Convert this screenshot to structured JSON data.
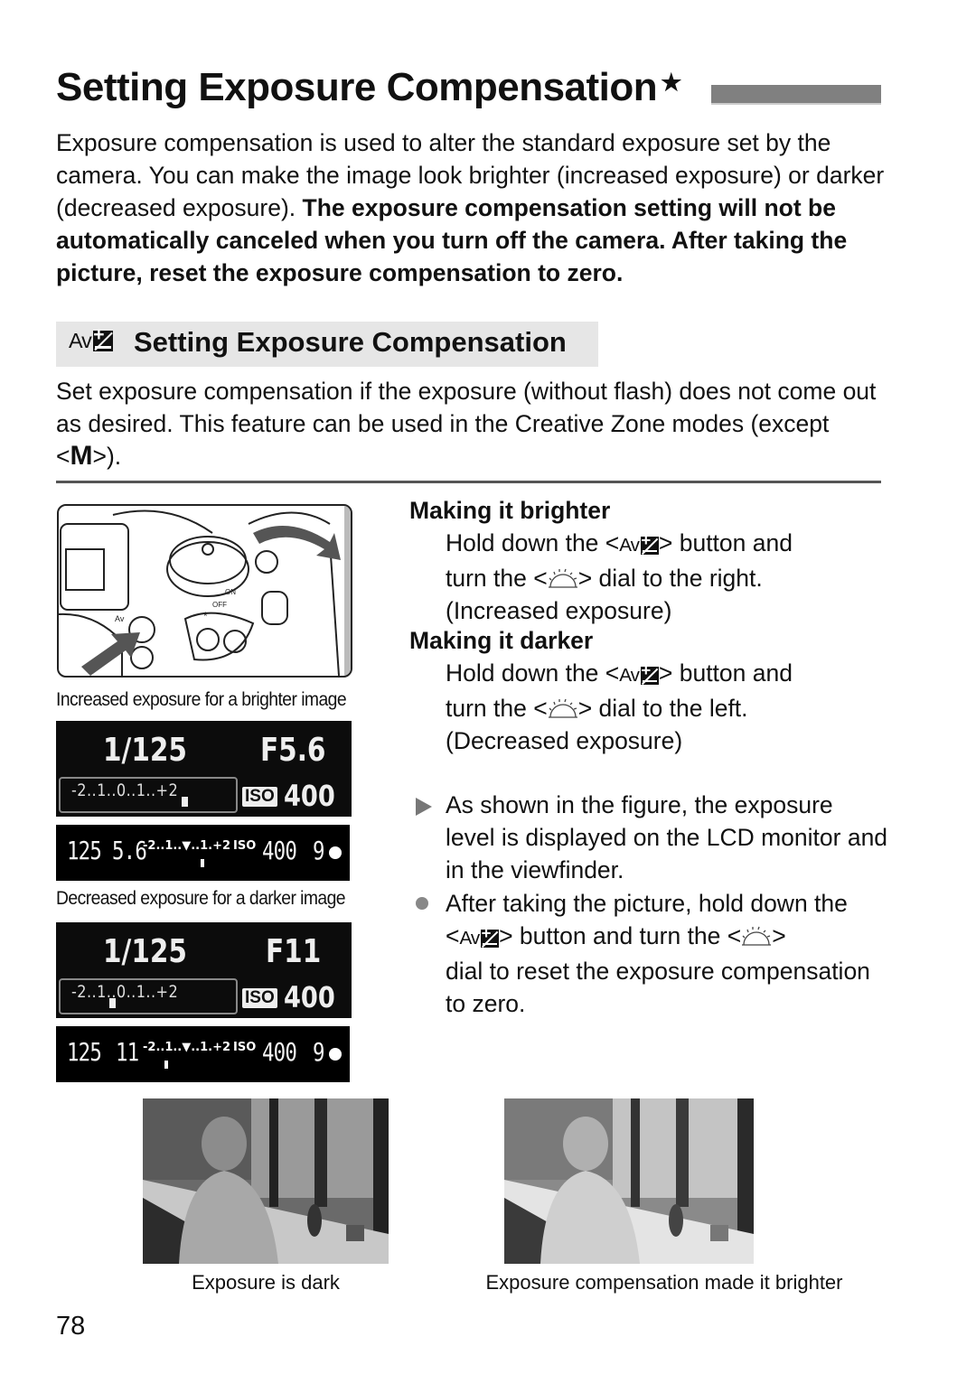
{
  "page": {
    "title": "Setting Exposure Compensation",
    "title_marker": "★",
    "intro_normal": "Exposure compensation is used to alter the standard exposure set by the camera. You can make the image look brighter (increased exposure) or darker (decreased exposure). ",
    "intro_bold": "The exposure compensation setting will not be automatically canceled when you turn off the camera. After taking the picture, reset the exposure compensation to zero.",
    "section": {
      "icon": "Av±",
      "icon_av": "Av",
      "heading": "Setting Exposure Compensation",
      "desc_before": "Set exposure compensation if the exposure (without flash) does not come out as desired. This feature can be used in the Creative Zone modes (except <",
      "desc_mode": "M",
      "desc_after": ">)."
    },
    "figures": {
      "brighter_caption": "Increased exposure for a brighter image",
      "darker_caption": "Decreased exposure for a darker image",
      "lcd_scale": "-2..1..0..1..+2",
      "iso_label": "ISO",
      "lcd_brighter": {
        "shutter": "1/125",
        "aperture": "F5.6",
        "iso": "400",
        "compensation_stops": 1
      },
      "lcd_darker": {
        "shutter": "1/125",
        "aperture": "F11",
        "iso": "400",
        "compensation_stops": -1
      },
      "vf_brighter": {
        "shutter": "125",
        "aperture": "5.6",
        "scale": "-2..1..▼..1.+2",
        "iso_label": "ISO",
        "iso": "400",
        "shots": "9"
      },
      "vf_darker": {
        "shutter": "125",
        "aperture": "11",
        "scale": "-2..1..▼..1.+2",
        "iso_label": "ISO",
        "iso": "400",
        "shots": "9"
      }
    },
    "steps": {
      "brighter_heading": "Making it brighter",
      "brighter_l1a": "Hold down the <",
      "brighter_l1b": "> button and",
      "brighter_l2a": "turn the <",
      "brighter_l2b": "> dial to the right.",
      "brighter_l3": "(Increased exposure)",
      "darker_heading": "Making it darker",
      "darker_l1a": "Hold down the <",
      "darker_l1b": "> button and",
      "darker_l2a": "turn the <",
      "darker_l2b": "> dial to the left.",
      "darker_l3": "(Decreased exposure)"
    },
    "notes": {
      "note1": "As shown in the figure, the exposure level is displayed on the LCD monitor and in the viewfinder.",
      "note2_a": "After taking the picture, hold down the",
      "note2_b1": "<",
      "note2_b2": "> button and turn the <",
      "note2_b3": ">",
      "note2_c": "dial to reset the exposure compensation to zero."
    },
    "photos": {
      "dark_caption": "Exposure is dark",
      "bright_caption": "Exposure compensation made it brighter"
    },
    "page_number": "78"
  }
}
